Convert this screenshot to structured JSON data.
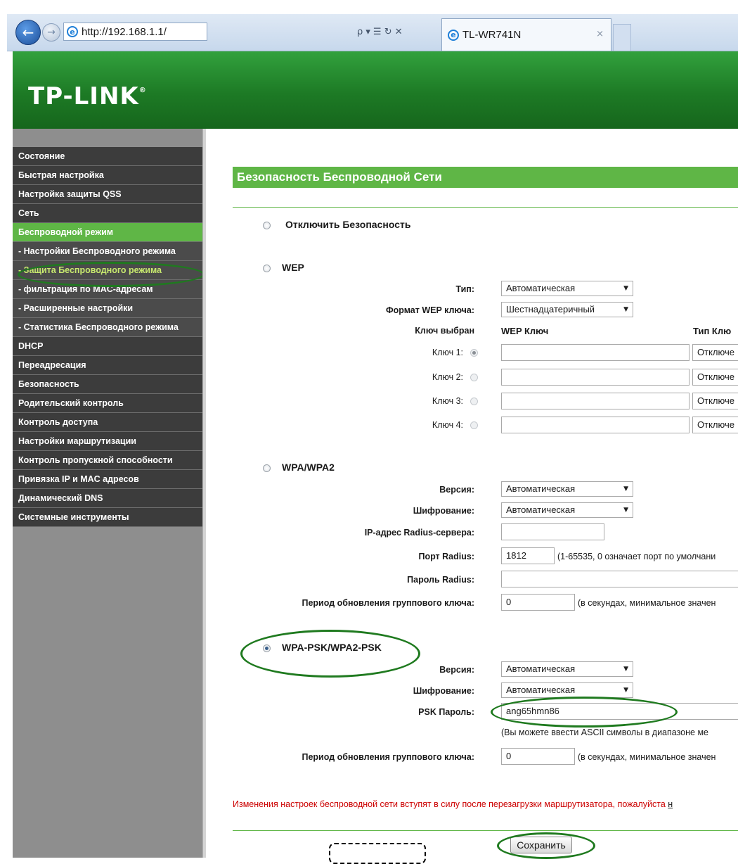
{
  "browser": {
    "address": "http://192.168.1.1/",
    "tab_title": "TL-WR741N",
    "tab_close": "×",
    "back_glyph": "←",
    "fwd_glyph": "→",
    "search_glyph": "ρ ▾",
    "tool_glyphs": "☰ ↻ ✕"
  },
  "header": {
    "logo": "TP-LINK",
    "logo_mark": "®"
  },
  "menu": [
    {
      "label": "Состояние"
    },
    {
      "label": "Быстрая настройка"
    },
    {
      "label": "Настройка защиты QSS"
    },
    {
      "label": "Сеть"
    },
    {
      "label": "Беспроводной режим"
    },
    {
      "label": "- Настройки Беспроводного режима"
    },
    {
      "label": "- Защита Беспроводного режима"
    },
    {
      "label": "- фильтрация по MAC-адресам"
    },
    {
      "label": "- Расширенные настройки"
    },
    {
      "label": "- Статистика Беспроводного режима"
    },
    {
      "label": "DHCP"
    },
    {
      "label": "Переадресация"
    },
    {
      "label": "Безопасность"
    },
    {
      "label": "Родительский контроль"
    },
    {
      "label": "Контроль доступа"
    },
    {
      "label": "Настройки маршрутизации"
    },
    {
      "label": "Контроль пропускной способности"
    },
    {
      "label": "Привязка IP и MAC адресов"
    },
    {
      "label": "Динамический DNS"
    },
    {
      "label": "Системные инструменты"
    }
  ],
  "page": {
    "title": "Безопасность Беспроводной Сети",
    "disable": {
      "label": "Отключить Безопасность"
    },
    "wep": {
      "label": "WEP",
      "type_label": "Тип:",
      "type_value": "Автоматическая",
      "format_label": "Формат WEP ключа:",
      "format_value": "Шестнадцатеричный",
      "col_selected": "Ключ выбран",
      "col_key": "WEP Ключ",
      "col_type": "Тип Клю",
      "keys": [
        {
          "label": "Ключ 1:",
          "type": "Отключе"
        },
        {
          "label": "Ключ 2:",
          "type": "Отключе"
        },
        {
          "label": "Ключ 3:",
          "type": "Отключе"
        },
        {
          "label": "Ключ 4:",
          "type": "Отключе"
        }
      ]
    },
    "wpa": {
      "label": "WPA/WPA2",
      "version_label": "Версия:",
      "version_value": "Автоматическая",
      "enc_label": "Шифрование:",
      "enc_value": "Автоматическая",
      "radius_ip_label": "IP-адрес Radius-сервера:",
      "radius_port_label": "Порт Radius:",
      "radius_port_value": "1812",
      "radius_port_hint": "(1-65535, 0 означает порт по умолчани",
      "radius_pass_label": "Пароль Radius:",
      "group_label": "Период обновления группового ключа:",
      "group_value": "0",
      "group_hint": "(в секундах, минимальное значен"
    },
    "psk": {
      "label": "WPA-PSK/WPA2-PSK",
      "version_label": "Версия:",
      "version_value": "Автоматическая",
      "enc_label": "Шифрование:",
      "enc_value": "Автоматическая",
      "pass_label": "PSK Пароль:",
      "pass_value": "ang65hmn86",
      "pass_hint": "(Вы можете ввести ASCII символы в диапазоне ме",
      "group_label": "Период обновления группового ключа:",
      "group_value": "0",
      "group_hint": "(в секундах, минимальное значен"
    },
    "notice": "Изменения настроек беспроводной сети вступят в силу после перезагрузки маршрутизатора, пожалуйста ",
    "notice_link": "н",
    "save_label": "Сохранить",
    "select_arrow": "▼"
  }
}
